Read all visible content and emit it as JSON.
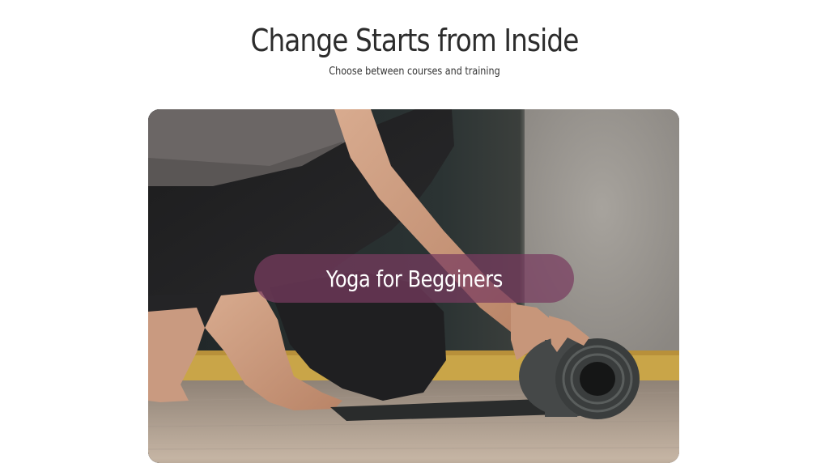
{
  "header": {
    "title": "Change Starts from Inside",
    "subtitle": "Choose between courses and training"
  },
  "hero": {
    "image_alt": "Person kneeling and rolling up a yoga mat",
    "course_title": "Yoga for Begginers"
  },
  "colors": {
    "title": "#2c2c2c",
    "pill": "#783c5f",
    "pill_text": "#ffffff"
  }
}
